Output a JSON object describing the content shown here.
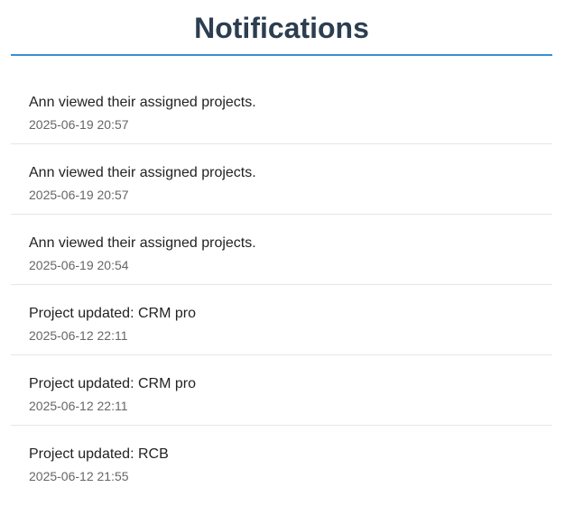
{
  "header": {
    "title": "Notifications"
  },
  "notifications": [
    {
      "message": "Ann viewed their assigned projects.",
      "time": "2025-06-19 20:57"
    },
    {
      "message": "Ann viewed their assigned projects.",
      "time": "2025-06-19 20:57"
    },
    {
      "message": "Ann viewed their assigned projects.",
      "time": "2025-06-19 20:54"
    },
    {
      "message": "Project updated: CRM pro",
      "time": "2025-06-12 22:11"
    },
    {
      "message": "Project updated: CRM pro",
      "time": "2025-06-12 22:11"
    },
    {
      "message": "Project updated: RCB",
      "time": "2025-06-12 21:55"
    }
  ],
  "colors": {
    "title": "#2c3e50",
    "accent_rule": "#3b8fd6",
    "divider": "#e6e6e6",
    "timestamp": "#666666"
  }
}
